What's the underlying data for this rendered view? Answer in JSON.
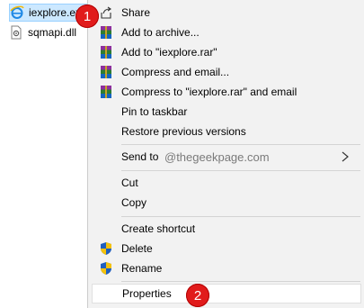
{
  "files": [
    {
      "name": "iexplore.ex",
      "icon": "internet-explorer-icon",
      "selected": true
    },
    {
      "name": "sqmapi.dll",
      "icon": "dll-file-icon",
      "selected": false
    }
  ],
  "context_menu": {
    "items": [
      {
        "label": "Share",
        "icon": "share-icon"
      },
      {
        "label": "Add to archive...",
        "icon": "winrar-icon"
      },
      {
        "label": "Add to \"iexplore.rar\"",
        "icon": "winrar-icon"
      },
      {
        "label": "Compress and email...",
        "icon": "winrar-icon"
      },
      {
        "label": "Compress to \"iexplore.rar\" and email",
        "icon": "winrar-icon"
      },
      {
        "label": "Pin to taskbar",
        "icon": ""
      },
      {
        "label": "Restore previous versions",
        "icon": ""
      },
      {
        "label": "Send to",
        "icon": "",
        "submenu": true
      },
      {
        "label": "Cut",
        "icon": ""
      },
      {
        "label": "Copy",
        "icon": ""
      },
      {
        "label": "Create shortcut",
        "icon": ""
      },
      {
        "label": "Delete",
        "icon": "uac-shield-icon"
      },
      {
        "label": "Rename",
        "icon": "uac-shield-icon"
      },
      {
        "label": "Properties",
        "icon": "",
        "highlighted": true
      }
    ]
  },
  "watermark": "@thegeekpage.com",
  "badges": {
    "step1": "1",
    "step2": "2"
  },
  "colors": {
    "menu_bg": "#f2f2f2",
    "selection_bg": "#cce8ff",
    "badge": "#e11b1b"
  }
}
